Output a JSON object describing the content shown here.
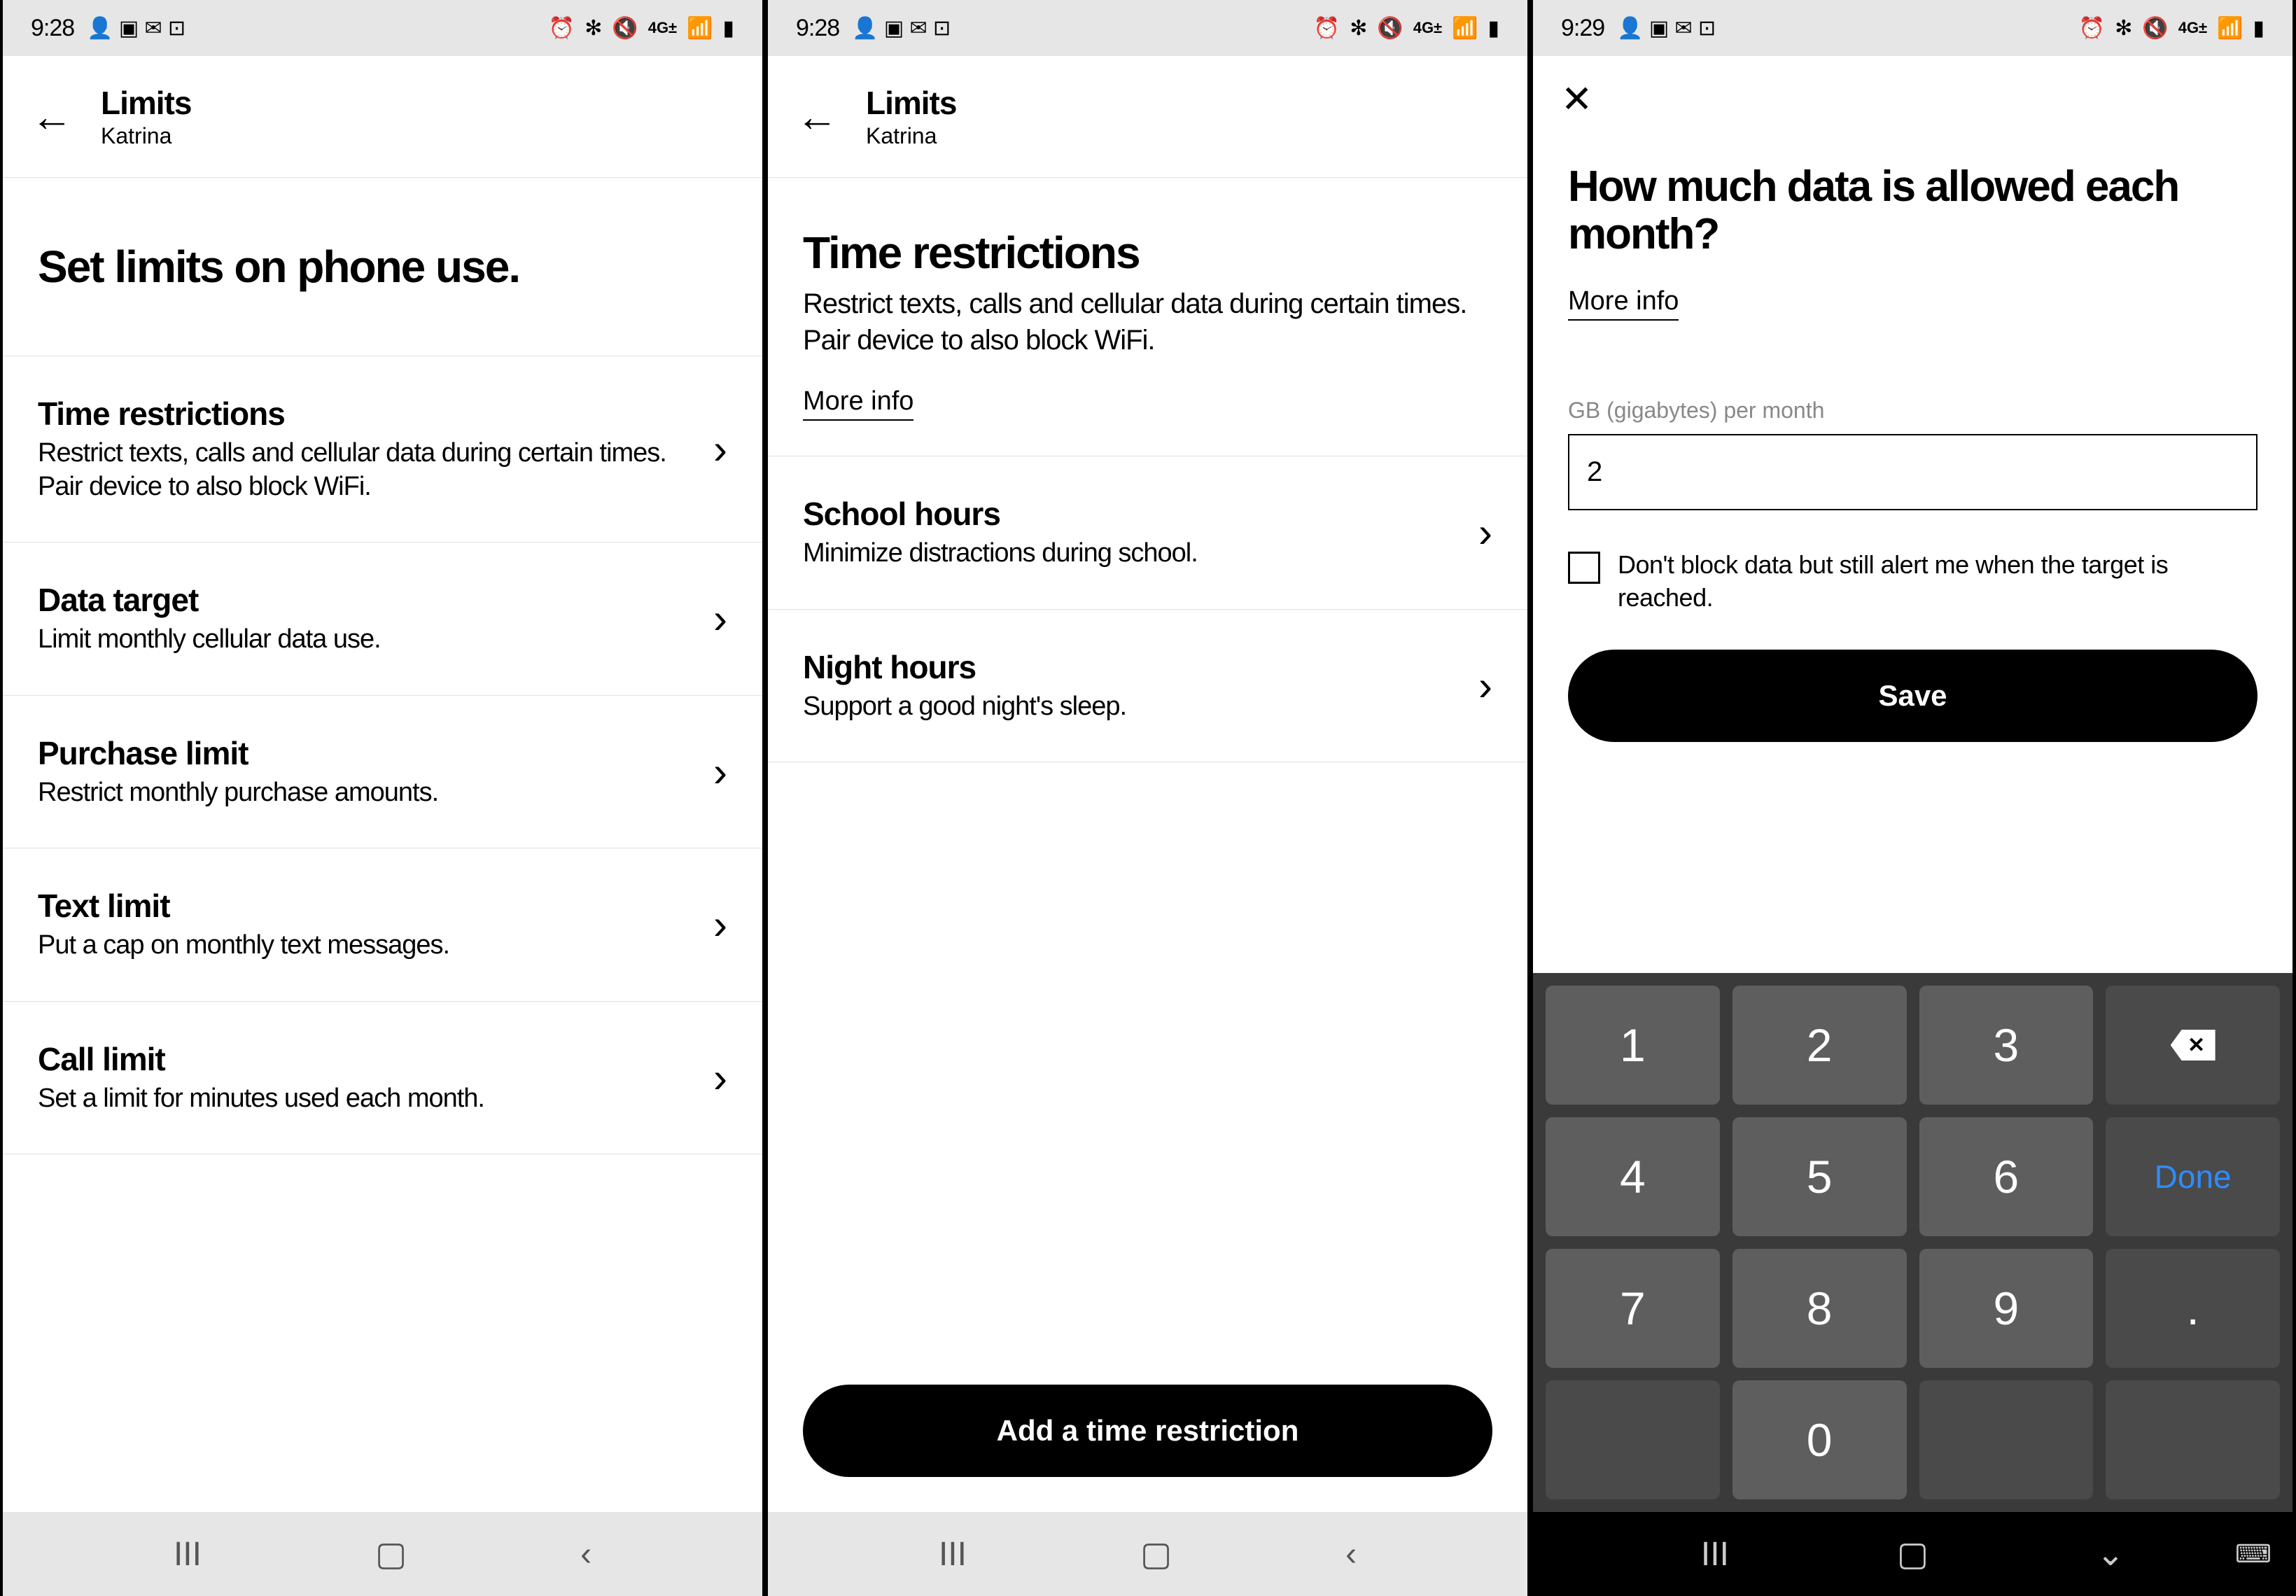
{
  "status": {
    "time1": "9:28",
    "time2": "9:28",
    "time3": "9:29",
    "network_label": "4G",
    "icons_left": "👤 ▣ M ⊡",
    "icons_right": "⏰ ✻ 🔇 📶 ▮"
  },
  "header": {
    "title": "Limits",
    "subtitle": "Katrina"
  },
  "screen1": {
    "heading": "Set limits on phone use.",
    "items": [
      {
        "title": "Time restrictions",
        "desc": "Restrict texts, calls and cellular data during certain times. Pair device to also block WiFi."
      },
      {
        "title": "Data target",
        "desc": "Limit monthly cellular data use."
      },
      {
        "title": "Purchase limit",
        "desc": "Restrict monthly purchase amounts."
      },
      {
        "title": "Text limit",
        "desc": "Put a cap on monthly text messages."
      },
      {
        "title": "Call limit",
        "desc": "Set a limit for minutes used each month."
      }
    ]
  },
  "screen2": {
    "heading": "Time restrictions",
    "desc": "Restrict texts, calls and cellular data during certain times. Pair device to also block WiFi.",
    "more_info": "More info",
    "items": [
      {
        "title": "School hours",
        "desc": "Minimize distractions during school."
      },
      {
        "title": "Night hours",
        "desc": "Support a good night's sleep."
      }
    ],
    "button": "Add a time restriction"
  },
  "screen3": {
    "heading": "How much data is allowed each month?",
    "more_info": "More info",
    "input_label": "GB (gigabytes) per month",
    "input_value": "2",
    "checkbox_label": "Don't block data but still alert me when the target is reached.",
    "save": "Save",
    "keys": [
      "1",
      "2",
      "3",
      "⌫",
      "4",
      "5",
      "6",
      "Done",
      "7",
      "8",
      "9",
      ".",
      "",
      "0",
      "",
      ""
    ]
  }
}
